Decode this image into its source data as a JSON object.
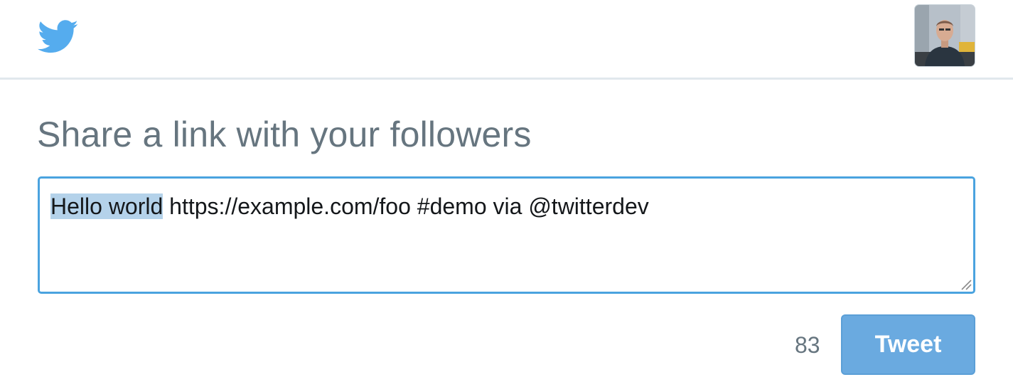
{
  "header": {
    "logo_icon": "twitter-bird-icon",
    "avatar_icon": "user-avatar",
    "brand_color": "#55acee"
  },
  "composer": {
    "title": "Share a link with your followers",
    "selected_text": "Hello world",
    "rest_text": " https://example.com/foo #demo via @twitterdev",
    "border_color": "#4aa3df"
  },
  "footer": {
    "char_count": "83",
    "tweet_label": "Tweet",
    "button_color": "#6aaae0"
  }
}
